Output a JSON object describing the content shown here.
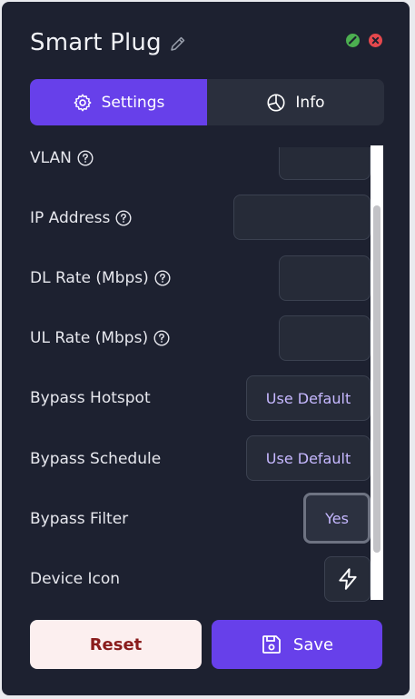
{
  "window": {
    "title": "Smart Plug",
    "colors": {
      "panel": "#1d2130",
      "accent": "#6740ea",
      "ok": "#4caf50",
      "close": "#e5484d"
    }
  },
  "tabs": [
    {
      "label": "Settings",
      "icon": "gear-icon",
      "active": true
    },
    {
      "label": "Info",
      "icon": "pie-chart-icon",
      "active": false
    }
  ],
  "settings": {
    "vlan": {
      "label": "VLAN",
      "value": ""
    },
    "ip_address": {
      "label": "IP Address",
      "value": ""
    },
    "dl_rate": {
      "label": "DL Rate (Mbps)",
      "value": ""
    },
    "ul_rate": {
      "label": "UL Rate (Mbps)",
      "value": ""
    },
    "bypass_hotspot": {
      "label": "Bypass Hotspot",
      "value": "Use Default"
    },
    "bypass_schedule": {
      "label": "Bypass Schedule",
      "value": "Use Default"
    },
    "bypass_filter": {
      "label": "Bypass Filter",
      "value": "Yes"
    },
    "device_icon": {
      "label": "Device Icon",
      "icon": "lightning-bolt-icon"
    }
  },
  "footer": {
    "reset_label": "Reset",
    "save_label": "Save"
  }
}
